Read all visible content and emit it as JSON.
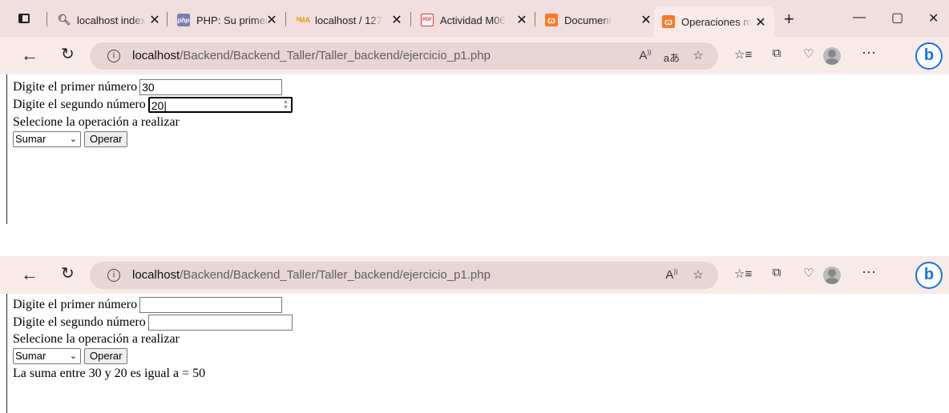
{
  "browser": {
    "tabs": [
      {
        "title": "localhost index",
        "icon": "search-icon"
      },
      {
        "title": "PHP: Su primer",
        "icon": "php-icon"
      },
      {
        "title": "localhost / 127",
        "icon": "phpmyadmin-icon"
      },
      {
        "title": "Actividad M06",
        "icon": "pdf-icon"
      },
      {
        "title": "Document",
        "icon": "xampp-icon"
      },
      {
        "title": "Operaciones m",
        "icon": "xampp-icon",
        "active": true
      }
    ],
    "favicon_labels": {
      "php": "php",
      "pma": "PMA",
      "pdf": "PDF",
      "xampp": "ꞷ"
    },
    "address": {
      "host": "localhost",
      "path": "/Backend/Backend_Taller/Taller_backend/ejercicio_p1.php"
    }
  },
  "form1": {
    "label1": "Digite el primer número",
    "value1": "30",
    "label2": "Digite el segundo número",
    "value2": "20",
    "label3": "Selecione la operación a realizar",
    "select_value": "Sumar",
    "submit_label": "Operar"
  },
  "form2": {
    "label1": "Digite el primer número",
    "value1": "",
    "label2": "Digite el segundo número",
    "value2": "",
    "label3": "Selecione la operación a realizar",
    "select_value": "Sumar",
    "submit_label": "Operar",
    "result": "La suma entre 30 y 20 es igual a = 50"
  }
}
